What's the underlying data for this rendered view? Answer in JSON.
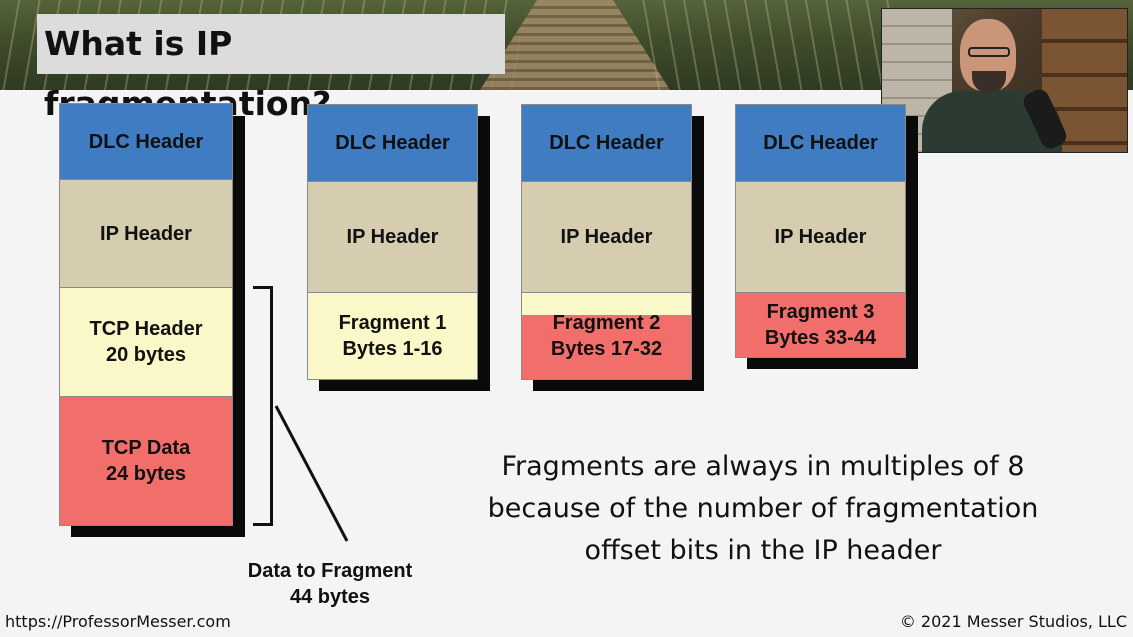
{
  "slide": {
    "title": "What is IP fragmentation?"
  },
  "original_packet": {
    "dlc": "DLC Header",
    "ip": "IP Header",
    "tcp_header": "TCP Header\n20 bytes",
    "tcp_data": "TCP Data\n24 bytes"
  },
  "data_to_fragment": "Data to Fragment\n44 bytes",
  "fragments": [
    {
      "dlc": "DLC Header",
      "ip": "IP Header",
      "data": "Fragment 1\nBytes 1-16"
    },
    {
      "dlc": "DLC Header",
      "ip": "IP Header",
      "data": "Fragment 2\nBytes 17-32"
    },
    {
      "dlc": "DLC Header",
      "ip": "IP Header",
      "data": "Fragment 3\nBytes 33-44"
    }
  ],
  "note": "Fragments are always in multiples of 8\nbecause of the number of fragmentation\noffset bits in the IP header",
  "footer": {
    "url": "https://ProfessorMesser.com",
    "copyright": "© 2021 Messer Studios, LLC"
  },
  "colors": {
    "dlc": "#3f7cc1",
    "ip": "#d6ccaf",
    "tcp_header": "#faf7c8",
    "tcp_data": "#f26e6b"
  }
}
